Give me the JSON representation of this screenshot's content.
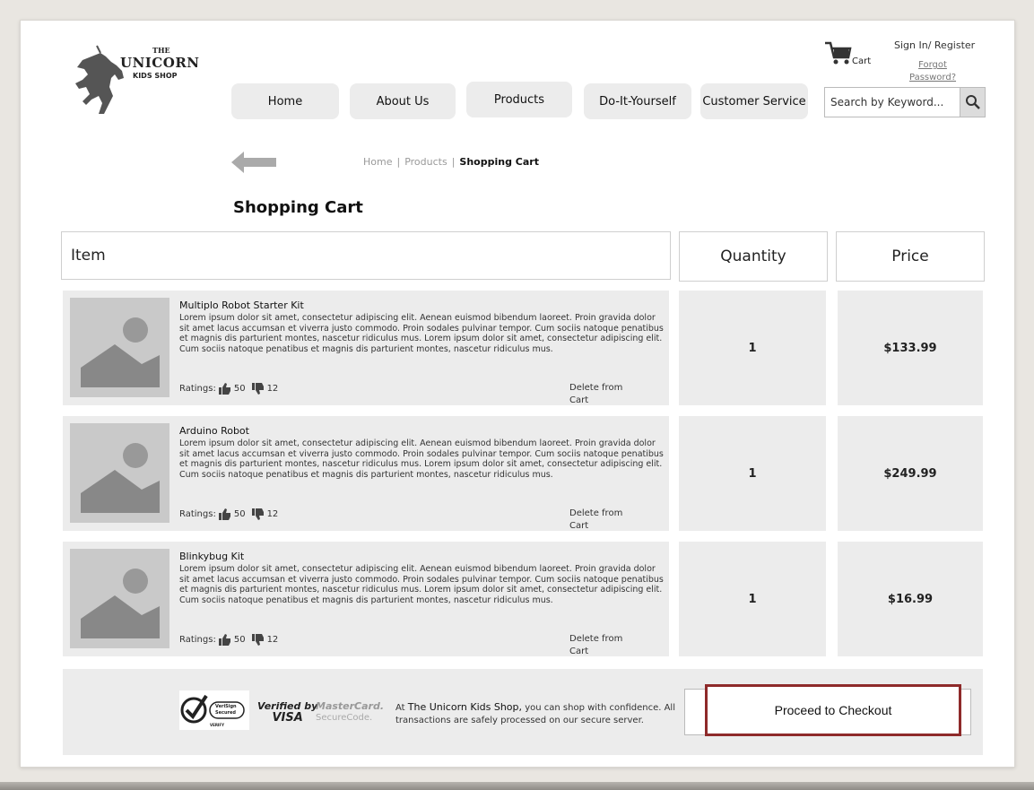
{
  "logo": {
    "the": "THE",
    "name": "UNICORN",
    "sub": "KIDS SHOP"
  },
  "nav": [
    "Home",
    "About Us",
    "Products",
    "Do-It-Yourself",
    "Customer Service"
  ],
  "header": {
    "cart_label": "Cart",
    "signin": "Sign In/ Register",
    "forgot_1": "Forgot",
    "forgot_2": "Password?",
    "search_placeholder": "Search by Keyword..."
  },
  "breadcrumb": {
    "home": "Home",
    "sep": "|",
    "products": "Products",
    "current": "Shopping Cart"
  },
  "page_title": "Shopping Cart",
  "table": {
    "headers": {
      "item": "Item",
      "quantity": "Quantity",
      "price": "Price"
    },
    "rows": [
      {
        "name": "Multiplo Robot Starter Kit",
        "description": "Lorem ipsum dolor sit amet, consectetur adipiscing elit. Aenean euismod bibendum laoreet. Proin gravida dolor sit amet lacus accumsan et viverra justo commodo. Proin sodales pulvinar tempor. Cum sociis natoque penatibus et magnis dis parturient montes, nascetur ridiculus mus. Lorem ipsum dolor sit amet, consectetur adipiscing elit. Cum sociis natoque penatibus et magnis dis parturient montes, nascetur ridiculus mus.",
        "ratings_label": "Ratings:",
        "likes": "50",
        "dislikes": "12",
        "delete": "Delete from Cart",
        "quantity": "1",
        "price": "$133.99"
      },
      {
        "name": "Arduino Robot",
        "description": "Lorem ipsum dolor sit amet, consectetur adipiscing elit. Aenean euismod bibendum laoreet. Proin gravida dolor sit amet lacus accumsan et viverra justo commodo. Proin sodales pulvinar tempor. Cum sociis natoque penatibus et magnis dis parturient montes, nascetur ridiculus mus. Lorem ipsum dolor sit amet, consectetur adipiscing elit. Cum sociis natoque penatibus et magnis dis parturient montes, nascetur ridiculus mus.",
        "ratings_label": "Ratings:",
        "likes": "50",
        "dislikes": "12",
        "delete": "Delete from Cart",
        "quantity": "1",
        "price": "$249.99"
      },
      {
        "name": "Blinkybug Kit",
        "description": "Lorem ipsum dolor sit amet, consectetur adipiscing elit. Aenean euismod bibendum laoreet. Proin gravida dolor sit amet lacus accumsan et viverra justo commodo. Proin sodales pulvinar tempor. Cum sociis natoque penatibus et magnis dis parturient montes, nascetur ridiculus mus. Lorem ipsum dolor sit amet, consectetur adipiscing elit. Cum sociis natoque penatibus et magnis dis parturient montes, nascetur ridiculus mus.",
        "ratings_label": "Ratings:",
        "likes": "50",
        "dislikes": "12",
        "delete": "Delete from Cart",
        "quantity": "1",
        "price": "$16.99"
      }
    ]
  },
  "footer": {
    "verified_1": "Verified by",
    "verified_2": "VISA",
    "mastercard_1": "MasterCard.",
    "mastercard_2": "SecureCode.",
    "verisign_1": "VeriSign",
    "verisign_2": "Secured",
    "verisign_3": "VERIFY",
    "confidence_pre": "At ",
    "confidence_brand": "The Unicorn Kids Shop,",
    "confidence_post": " you can shop with confidence. All transactions are safely processed on our secure server.",
    "checkout": "Proceed to Checkout"
  },
  "colors": {
    "panel": "#ececec",
    "checkout_border": "#8e2a2a",
    "background": "#e9e6e1"
  },
  "icons": [
    "unicorn-logo-icon",
    "shopping-cart-icon",
    "search-icon",
    "back-arrow-icon",
    "image-placeholder-icon",
    "thumbs-up-icon",
    "thumbs-down-icon",
    "verisign-check-icon"
  ]
}
